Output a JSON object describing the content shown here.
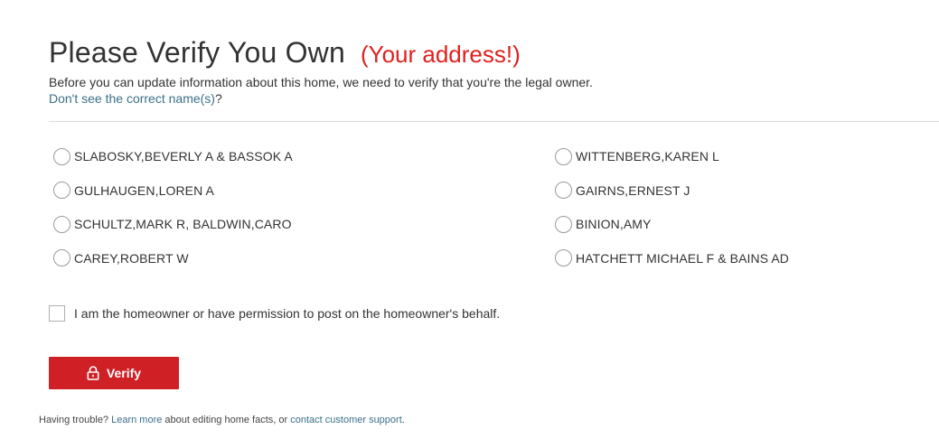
{
  "header": {
    "title": "Please Verify You Own",
    "address_note": "(Your address!)",
    "subtitle": "Before you can update information about this home, we need to verify that you're the legal owner.",
    "names_link": "Don't see the correct name(s)",
    "names_link_suffix": "?"
  },
  "owners": [
    {
      "label": "SLABOSKY,BEVERLY A & BASSOK A",
      "selected": false
    },
    {
      "label": "WITTENBERG,KAREN L",
      "selected": false
    },
    {
      "label": "GULHAUGEN,LOREN A",
      "selected": false
    },
    {
      "label": "GAIRNS,ERNEST J",
      "selected": false
    },
    {
      "label": "SCHULTZ,MARK R, BALDWIN,CARO",
      "selected": false
    },
    {
      "label": "BINION,AMY",
      "selected": false
    },
    {
      "label": "CAREY,ROBERT W",
      "selected": false
    },
    {
      "label": "HATCHETT MICHAEL F & BAINS AD",
      "selected": false
    }
  ],
  "consent": {
    "label": "I am the homeowner or have permission to post on the homeowner's behalf.",
    "checked": false
  },
  "verify_button": {
    "label": "Verify",
    "icon": "lock-icon"
  },
  "footer": {
    "prefix": "Having trouble? ",
    "learn_more": "Learn more",
    "middle": " about editing home facts, or ",
    "contact": "contact customer support",
    "suffix": "."
  },
  "colors": {
    "address_note": "#e0201f",
    "button": "#cf2026",
    "link": "#3b6f8a"
  }
}
